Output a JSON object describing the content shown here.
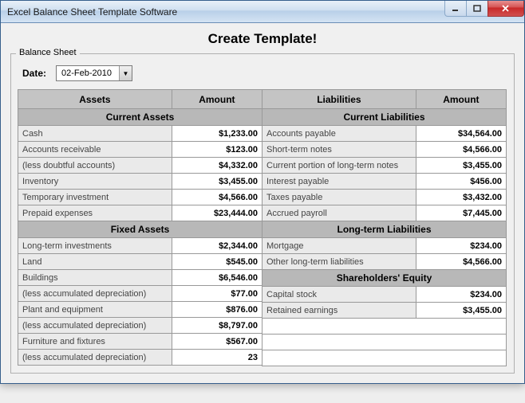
{
  "window": {
    "title": "Excel Balance Sheet Template Software"
  },
  "heading": "Create Template!",
  "fieldset_legend": "Balance Sheet",
  "date": {
    "label": "Date:",
    "value": "02-Feb-2010"
  },
  "headers": {
    "assets": "Assets",
    "amount": "Amount",
    "liabilities": "Liabilities"
  },
  "sections": {
    "current_assets": "Current Assets",
    "fixed_assets": "Fixed Assets",
    "current_liabilities": "Current Liabilities",
    "long_term_liabilities": "Long-term Liabilities",
    "shareholders_equity": "Shareholders' Equity"
  },
  "current_assets": [
    {
      "label": "Cash",
      "amount": "$1,233.00"
    },
    {
      "label": "Accounts receivable",
      "amount": "$123.00"
    },
    {
      "label": "(less doubtful accounts)",
      "amount": "$4,332.00"
    },
    {
      "label": "Inventory",
      "amount": "$3,455.00"
    },
    {
      "label": "Temporary investment",
      "amount": "$4,566.00"
    },
    {
      "label": "Prepaid expenses",
      "amount": "$23,444.00"
    }
  ],
  "fixed_assets": [
    {
      "label": "Long-term investments",
      "amount": "$2,344.00"
    },
    {
      "label": "Land",
      "amount": "$545.00"
    },
    {
      "label": "Buildings",
      "amount": "$6,546.00"
    },
    {
      "label": "(less accumulated depreciation)",
      "amount": "$77.00"
    },
    {
      "label": "Plant and equipment",
      "amount": "$876.00"
    },
    {
      "label": "(less accumulated depreciation)",
      "amount": "$8,797.00"
    },
    {
      "label": "Furniture and fixtures",
      "amount": "$567.00"
    },
    {
      "label": "(less accumulated depreciation)",
      "amount": "23"
    }
  ],
  "current_liabilities": [
    {
      "label": "Accounts payable",
      "amount": "$34,564.00"
    },
    {
      "label": "Short-term notes",
      "amount": "$4,566.00"
    },
    {
      "label": "Current portion of long-term notes",
      "amount": "$3,455.00"
    },
    {
      "label": "Interest payable",
      "amount": "$456.00"
    },
    {
      "label": "Taxes payable",
      "amount": "$3,432.00"
    },
    {
      "label": "Accrued payroll",
      "amount": "$7,445.00"
    }
  ],
  "long_term_liabilities": [
    {
      "label": "Mortgage",
      "amount": "$234.00"
    },
    {
      "label": "Other long-term liabilities",
      "amount": "$4,566.00"
    }
  ],
  "shareholders_equity": [
    {
      "label": "Capital stock",
      "amount": "$234.00"
    },
    {
      "label": "Retained earnings",
      "amount": "$3,455.00"
    }
  ]
}
